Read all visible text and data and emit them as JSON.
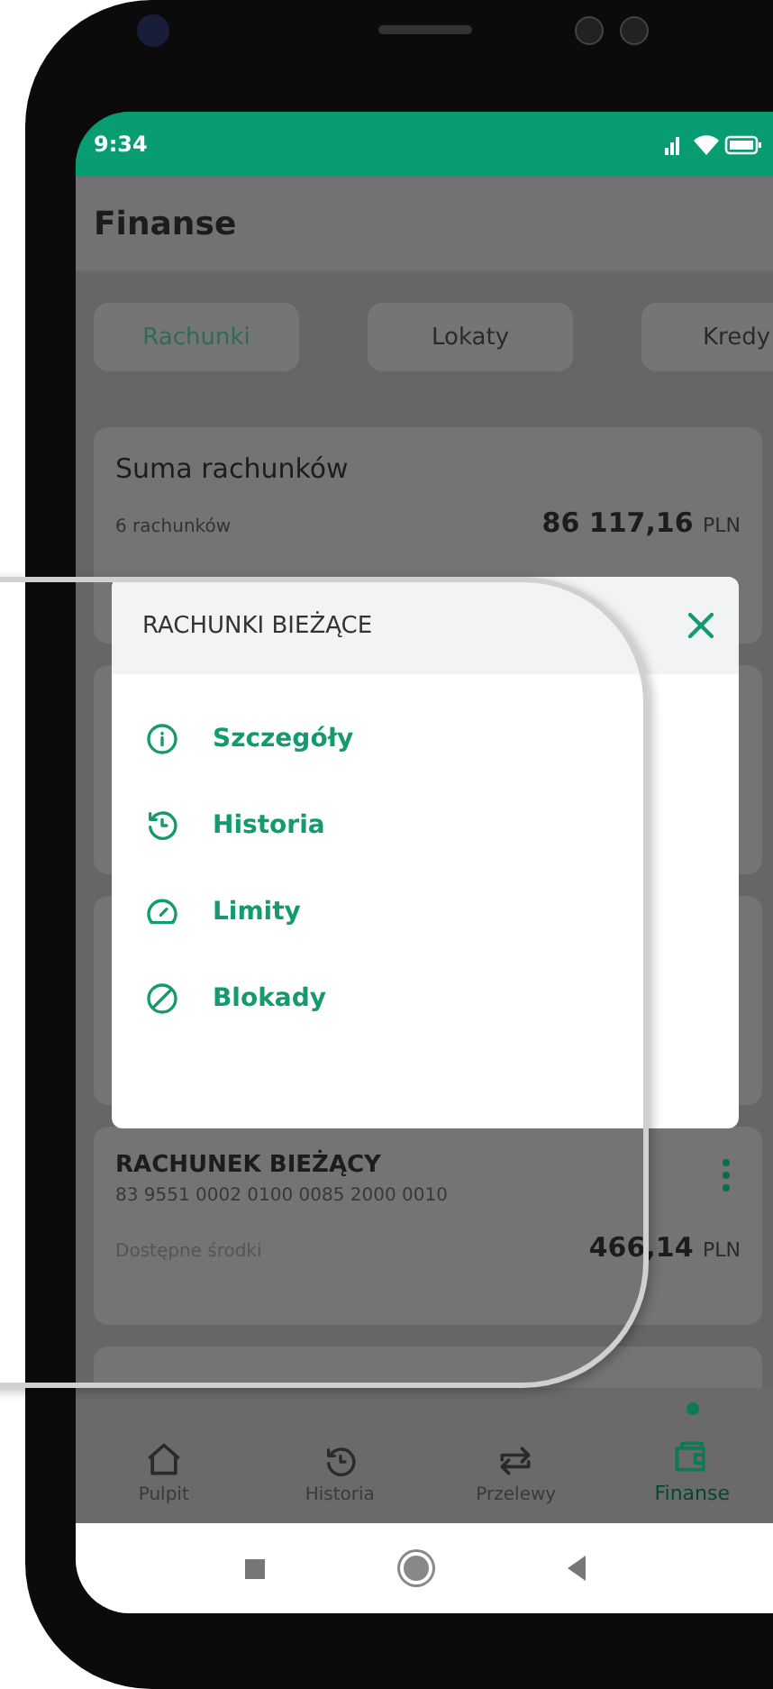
{
  "status_bar": {
    "time": "9:34"
  },
  "header": {
    "title": "Finanse"
  },
  "tabs": [
    {
      "label": "Rachunki",
      "selected": true
    },
    {
      "label": "Lokaty",
      "selected": false
    },
    {
      "label": "Kredy",
      "selected": false
    }
  ],
  "summary_card": {
    "title": "Suma rachunków",
    "count": "6 rachunków",
    "amount": "86 117,16",
    "currency": "PLN"
  },
  "menu": {
    "title": "RACHUNKI BIEŻĄCE",
    "items": [
      {
        "label": "Szczegóły",
        "kind": "info"
      },
      {
        "label": "Historia",
        "kind": "history"
      },
      {
        "label": "Limity",
        "kind": "gauge"
      },
      {
        "label": "Blokady",
        "kind": "block"
      }
    ]
  },
  "account_card": {
    "name": "RACHUNEK BIEŻĄCY",
    "number": "83 9551 0002 0100 0085 2000 0010",
    "label": "Dostępne środki",
    "amount": "466,14",
    "currency": "PLN"
  },
  "bottom_nav": [
    {
      "label": "Pulpit",
      "kind": "home",
      "selected": false
    },
    {
      "label": "Historia",
      "kind": "history",
      "selected": false
    },
    {
      "label": "Przelewy",
      "kind": "transfer",
      "selected": false
    },
    {
      "label": "Finanse",
      "kind": "wallet",
      "selected": true
    }
  ]
}
